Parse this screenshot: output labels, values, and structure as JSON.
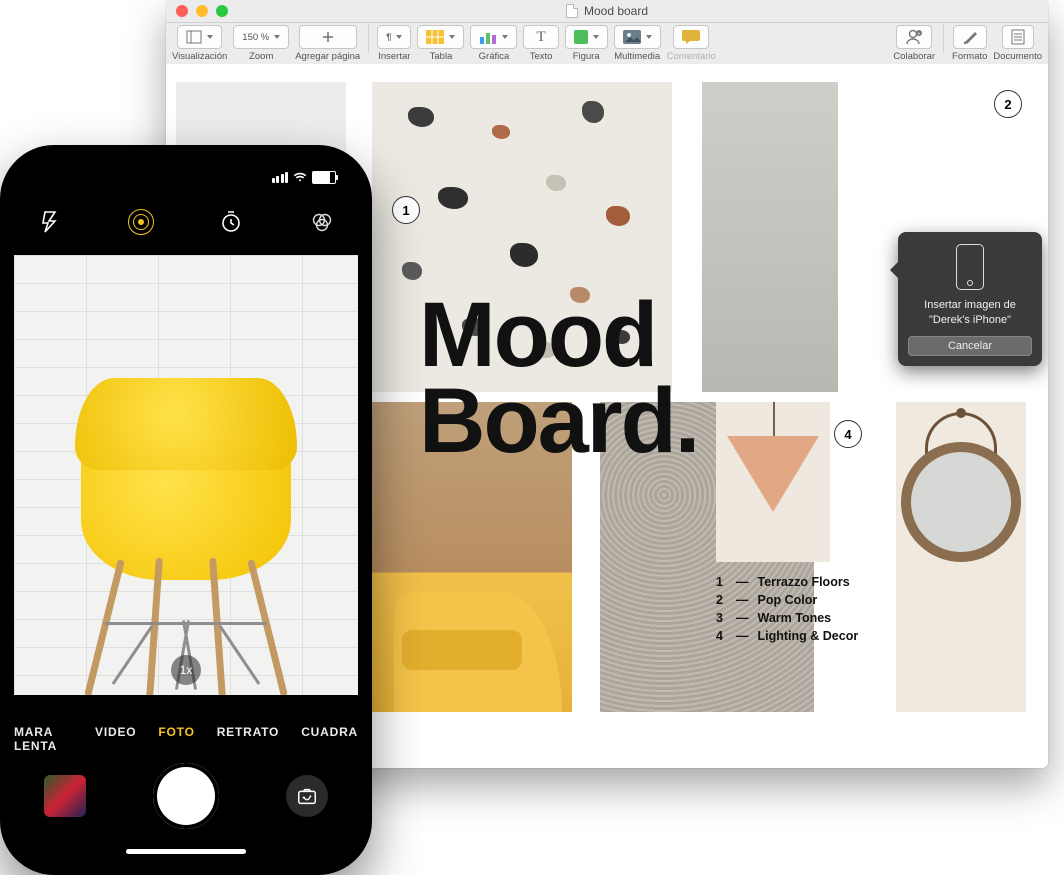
{
  "mac": {
    "title": "Mood board",
    "toolbar": {
      "view": "Visualización",
      "zoom_label": "Zoom",
      "zoom_value": "150 %",
      "add_page": "Agregar página",
      "insert": "Insertar",
      "table": "Tabla",
      "chart": "Gráfica",
      "text": "Texto",
      "shape": "Figura",
      "media": "Multimedia",
      "comment": "Comentario",
      "collaborate": "Colaborar",
      "format": "Formato",
      "document": "Documento"
    },
    "big_title_1": "Mood",
    "big_title_2": "Board.",
    "callouts": {
      "c1": "1",
      "c2": "2",
      "c4": "4"
    },
    "legend": [
      {
        "n": "1",
        "label": "Terrazzo Floors"
      },
      {
        "n": "2",
        "label": "Pop Color"
      },
      {
        "n": "3",
        "label": "Warm Tones"
      },
      {
        "n": "4",
        "label": "Lighting & Decor"
      }
    ],
    "popover": {
      "text": "Insertar imagen de \"Derek's iPhone\"",
      "cancel": "Cancelar"
    }
  },
  "iphone": {
    "zoom_pill": "1x",
    "modes": {
      "slow": "MARA LENTA",
      "video": "VIDEO",
      "photo": "FOTO",
      "portrait": "RETRATO",
      "square": "CUADRA"
    }
  }
}
